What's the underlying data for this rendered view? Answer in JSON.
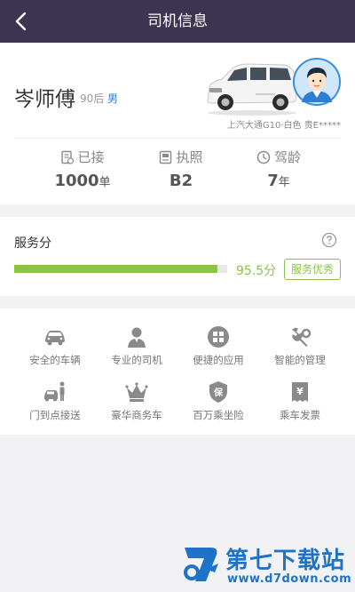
{
  "header": {
    "title": "司机信息"
  },
  "driver": {
    "name": "岑师傅",
    "age_group": "90后",
    "gender": "男",
    "car_info": "上汽大通G10·白色 贵E*****"
  },
  "stats": [
    {
      "label": "已接",
      "value": "1000",
      "unit": "单",
      "icon": "order-icon"
    },
    {
      "label": "执照",
      "value": "B2",
      "unit": "",
      "icon": "license-icon"
    },
    {
      "label": "驾龄",
      "value": "7",
      "unit": "年",
      "icon": "clock-icon"
    }
  ],
  "service_score": {
    "title": "服务分",
    "value": "95.5分",
    "progress": 0.955,
    "badge": "服务优秀"
  },
  "features": [
    {
      "label": "安全的车辆",
      "icon": "car-icon"
    },
    {
      "label": "专业的司机",
      "icon": "driver-icon"
    },
    {
      "label": "便捷的应用",
      "icon": "apps-icon"
    },
    {
      "label": "智能的管理",
      "icon": "tools-icon"
    },
    {
      "label": "门到点接送",
      "icon": "door-pickup-icon"
    },
    {
      "label": "豪华商务车",
      "icon": "crown-icon"
    },
    {
      "label": "百万乘坐险",
      "icon": "insurance-icon"
    },
    {
      "label": "乘车发票",
      "icon": "invoice-icon"
    }
  ],
  "watermark": {
    "title": "第七下载站",
    "url": "www.d7down.com"
  },
  "colors": {
    "header_bg": "#3d3452",
    "accent_green": "#8bc34a",
    "icon_gray": "#8a8a8a"
  }
}
